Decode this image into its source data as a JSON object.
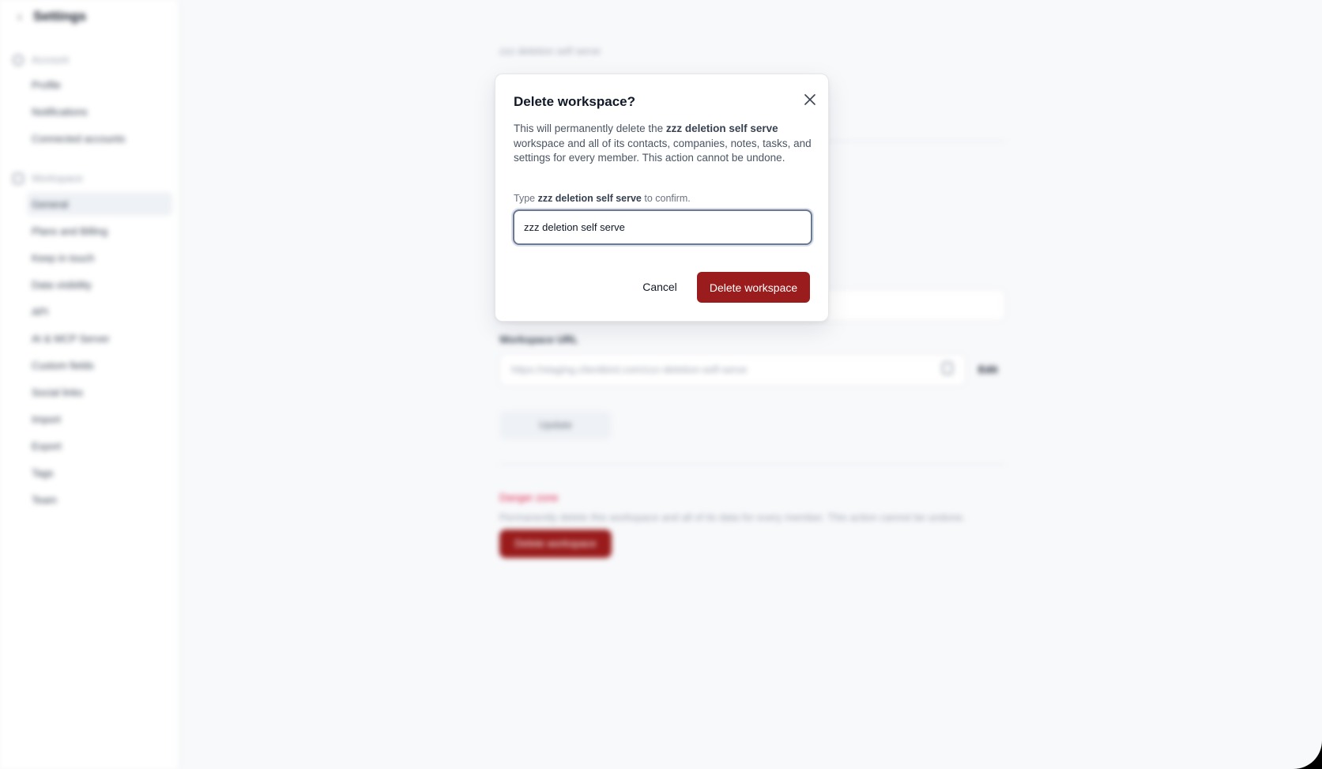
{
  "background": {
    "sidebar": {
      "title": "Settings",
      "sections": [
        {
          "label": "Account",
          "items": [
            "Profile",
            "Notifications",
            "Connected accounts"
          ]
        },
        {
          "label": "Workspace",
          "items": [
            "General",
            "Plans and Billing",
            "Keep in touch",
            "Data visibility",
            "API",
            "AI & MCP Server",
            "Custom fields",
            "Social links",
            "Import",
            "Export",
            "Tags",
            "Team"
          ]
        }
      ]
    },
    "main": {
      "title": "zzz deletion self serve",
      "url_label": "Workspace URL",
      "url_value": "https://staging.clientbird.com/zzz-deletion-self-serve",
      "edit_label": "Edit",
      "update_label": "Update",
      "danger_title": "Danger zone",
      "danger_desc": "Permanently delete this workspace and all of its data for every member. This action cannot be undone.",
      "danger_button": "Delete workspace"
    }
  },
  "modal": {
    "title": "Delete workspace?",
    "description_prefix": "This will permanently delete the ",
    "workspace_name": "zzz deletion self serve",
    "description_suffix": " workspace and all of its contacts, companies, notes, tasks, and settings for every member. This action cannot be undone.",
    "confirm_prefix": "Type ",
    "confirm_name": "zzz deletion self serve",
    "confirm_suffix": " to confirm.",
    "input_value": "zzz deletion self serve",
    "cancel_label": "Cancel",
    "delete_label": "Delete workspace"
  },
  "colors": {
    "danger": "#9b1c1c",
    "page_bg": "#f8f9fb"
  }
}
